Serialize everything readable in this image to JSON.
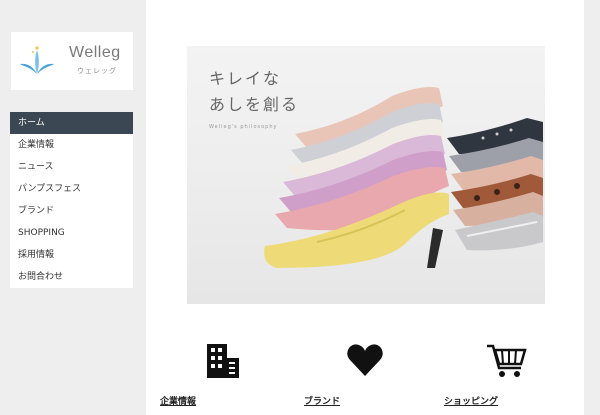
{
  "logo": {
    "name": "Welleg",
    "sub": "ウェレッグ"
  },
  "nav": {
    "items": [
      {
        "label": "ホーム",
        "active": true
      },
      {
        "label": "企業情報"
      },
      {
        "label": "ニュース"
      },
      {
        "label": "パンプスフェス"
      },
      {
        "label": "ブランド"
      },
      {
        "label": "SHOPPING"
      },
      {
        "label": "採用情報"
      },
      {
        "label": "お問合わせ"
      }
    ]
  },
  "hero": {
    "title_line1": "キレイな",
    "title_line2": "あしを創る",
    "subtitle": "Welleg's philosophy"
  },
  "features": [
    {
      "label": "企業情報",
      "icon": "building-icon"
    },
    {
      "label": "ブランド",
      "icon": "heart-icon"
    },
    {
      "label": "ショッピング",
      "icon": "cart-icon"
    }
  ],
  "colors": {
    "nav_active": "#3b4752",
    "accent_blue": "#4aa3d8",
    "accent_yellow": "#f0c94a"
  }
}
